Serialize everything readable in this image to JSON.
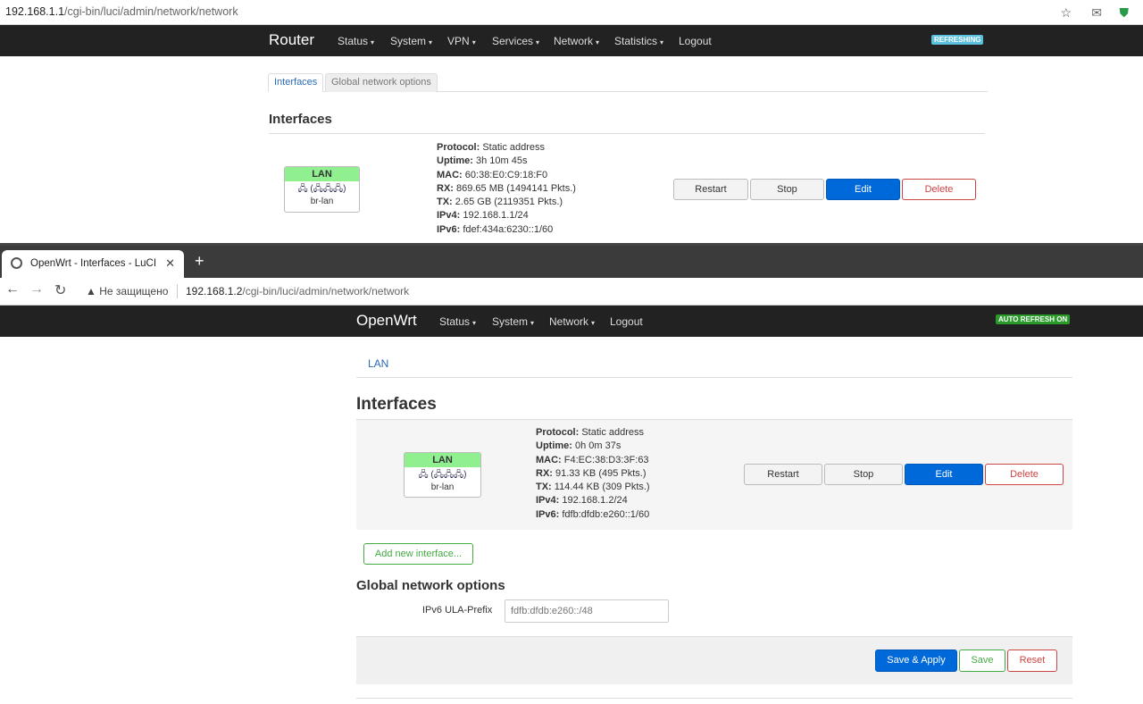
{
  "window1": {
    "address_url_host": "192.168.1.1",
    "address_url_path": "/cgi-bin/luci/admin/network/network",
    "brand": "Router",
    "menu": [
      {
        "label": "Status",
        "caret": "▾"
      },
      {
        "label": "System",
        "caret": "▾"
      },
      {
        "label": "VPN",
        "caret": "▾"
      },
      {
        "label": "Services",
        "caret": "▾"
      },
      {
        "label": "Network",
        "caret": "▾"
      },
      {
        "label": "Statistics",
        "caret": "▾"
      },
      {
        "label": "Logout",
        "caret": ""
      }
    ],
    "badge": "REFRESHING",
    "badge_color": "#5bc0de",
    "tabs": [
      "Interfaces",
      "Global network options"
    ],
    "section_title": "Interfaces",
    "iface": {
      "name": "LAN",
      "icons": "🖧 (🖧🖧🖧)",
      "device": "br-lan",
      "info": [
        {
          "k": "Protocol:",
          "v": "Static address"
        },
        {
          "k": "Uptime:",
          "v": "3h 10m 45s"
        },
        {
          "k": "MAC:",
          "v": "60:38:E0:C9:18:F0"
        },
        {
          "k": "RX:",
          "v": "869.65 MB (1494141 Pkts.)"
        },
        {
          "k": "TX:",
          "v": "2.65 GB (2119351 Pkts.)"
        },
        {
          "k": "IPv4:",
          "v": "192.168.1.1/24"
        },
        {
          "k": "IPv6:",
          "v": "fdef:434a:6230::1/60"
        }
      ]
    },
    "buttons": {
      "restart": "Restart",
      "stop": "Stop",
      "edit": "Edit",
      "delete": "Delete"
    }
  },
  "window2": {
    "tab_title": "OpenWrt - Interfaces - LuCI",
    "tab_close": "✕",
    "new_tab": "+",
    "nav_back": "←",
    "nav_forward": "→",
    "nav_reload": "↻",
    "security_icon": "▲",
    "security_text": "Не защищено",
    "url_host": "192.168.1.2",
    "url_path": "/cgi-bin/luci/admin/network/network",
    "brand": "OpenWrt",
    "menu": [
      {
        "label": "Status",
        "caret": "▾"
      },
      {
        "label": "System",
        "caret": "▾"
      },
      {
        "label": "Network",
        "caret": "▾"
      },
      {
        "label": "Logout",
        "caret": ""
      }
    ],
    "badge": "AUTO REFRESH ON",
    "badge_color": "#2a9a2a",
    "lan_link": "LAN",
    "section_title": "Interfaces",
    "iface": {
      "name": "LAN",
      "icons": "🖧 (🖧🖧🖧)",
      "device": "br-lan",
      "info": [
        {
          "k": "Protocol:",
          "v": "Static address"
        },
        {
          "k": "Uptime:",
          "v": "0h 0m 37s"
        },
        {
          "k": "MAC:",
          "v": "F4:EC:38:D3:3F:63"
        },
        {
          "k": "RX:",
          "v": "91.33 KB (495 Pkts.)"
        },
        {
          "k": "TX:",
          "v": "114.44 KB (309 Pkts.)"
        },
        {
          "k": "IPv4:",
          "v": "192.168.1.2/24"
        },
        {
          "k": "IPv6:",
          "v": "fdfb:dfdb:e260::1/60"
        }
      ]
    },
    "buttons": {
      "restart": "Restart",
      "stop": "Stop",
      "edit": "Edit",
      "delete": "Delete"
    },
    "add_interface": "Add new interface...",
    "global_title": "Global network options",
    "ula_label": "IPv6 ULA-Prefix",
    "ula_value": "fdfb:dfdb:e260::/48",
    "footer": {
      "save_apply": "Save & Apply",
      "save": "Save",
      "reset": "Reset"
    }
  },
  "browser_icons": {
    "star": "☆",
    "mail": "✉",
    "shield": "⛊"
  }
}
